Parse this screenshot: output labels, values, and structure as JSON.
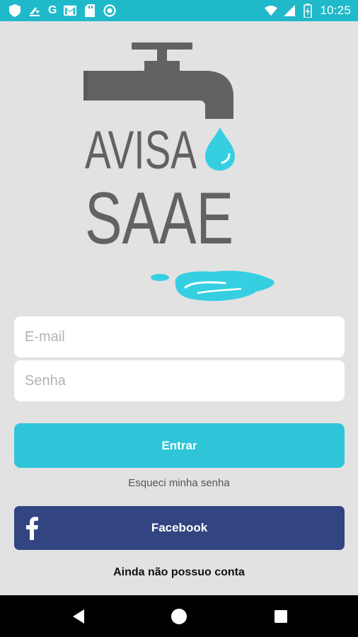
{
  "status_bar": {
    "left_icons": [
      "shield-icon",
      "download-icon",
      "google-icon",
      "gmail-icon",
      "sd-card-icon",
      "sync-icon"
    ],
    "google_letter": "G",
    "time": "10:25",
    "right_icons": [
      "wifi-icon",
      "signal-icon",
      "battery-icon"
    ]
  },
  "logo": {
    "line1": "AVISA",
    "line2": "SAAE",
    "colors": {
      "gray": "#626262",
      "water": "#36cfe2"
    }
  },
  "form": {
    "email_placeholder": "E-mail",
    "password_placeholder": "Senha",
    "login_label": "Entrar",
    "forgot_label": "Esqueci minha senha",
    "facebook_label": "Facebook",
    "signup_label": "Ainda não possuo conta"
  },
  "colors": {
    "status_bar": "#20b9c9",
    "background": "#e2e2e2",
    "login_button": "#2ec5d9",
    "facebook_button": "#334580"
  },
  "navbar": {
    "buttons": [
      "back-icon",
      "home-icon",
      "recents-icon"
    ]
  }
}
